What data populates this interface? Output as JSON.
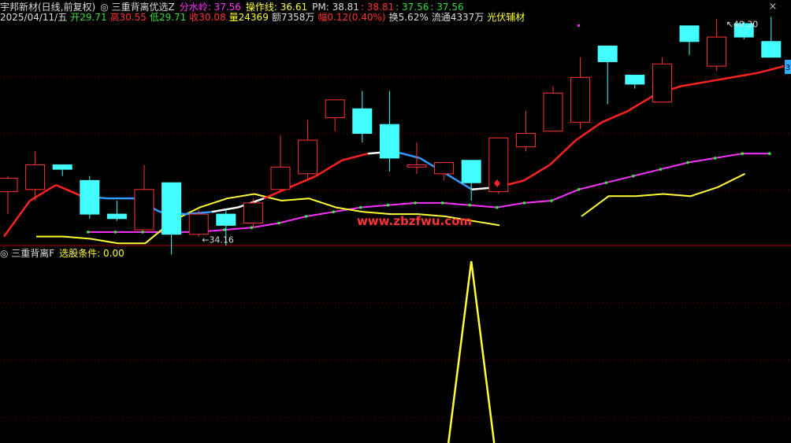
{
  "header": {
    "stock_name": "宇邦新材",
    "period": "(日线,前复权)",
    "indicator_name": "三重背离优选Z",
    "line1": [
      {
        "label": "分水岭:",
        "value": "37.56",
        "color": "#ff33ff"
      },
      {
        "label": "操作线:",
        "value": "36.61",
        "color": "#ffff33"
      },
      {
        "label": "PM:",
        "value": "38.81",
        "color": "#dddddd"
      },
      {
        "label": "",
        "value": ": 38.81",
        "color": "#ff3333"
      },
      {
        "label": "",
        "value": ": 37.56",
        "color": "#33dd33"
      },
      {
        "label": "",
        "value": ": 37.56",
        "color": "#33dd33"
      }
    ],
    "line2": [
      {
        "label": "2025/04/11/五",
        "value": "",
        "color": "#dddddd"
      },
      {
        "label": "开",
        "value": "29.71",
        "color": "#33dd33"
      },
      {
        "label": "高",
        "value": "30.55",
        "color": "#ff3333"
      },
      {
        "label": "低",
        "value": "29.71",
        "color": "#33dd33"
      },
      {
        "label": "收",
        "value": "30.08",
        "color": "#ff3333"
      },
      {
        "label": "量",
        "value": "24369",
        "color": "#ffff33"
      },
      {
        "label": "额",
        "value": "7358万",
        "color": "#dddddd"
      },
      {
        "label": "幅",
        "value": "0.12(0.40%)",
        "color": "#ff3333"
      },
      {
        "label": "换",
        "value": "5.62%",
        "color": "#dddddd"
      },
      {
        "label": "流通",
        "value": "4337万",
        "color": "#dddddd"
      },
      {
        "label": "光伏辅材",
        "value": "",
        "color": "#ffff33"
      }
    ]
  },
  "lower_panel": {
    "indicator_name": "三重背离F",
    "label": "选股条件:",
    "value": "0.00"
  },
  "watermark": "www.zbzfwu.com",
  "right_edge_label": "3",
  "close_icon": "×",
  "colors": {
    "up": "#ff3333",
    "down": "#44ffff",
    "fenshuiling": "#ff33ff",
    "caozuo": "#ffff33",
    "pm_up": "#ff2222",
    "pm_neutral": "#ffffff",
    "pm_down": "#3399ff",
    "grid": "#8b0000"
  },
  "chart_data": {
    "type": "candlestick",
    "candles": [
      {
        "o": 34.9,
        "c": 35.5,
        "h": 35.6,
        "l": 33.9
      },
      {
        "o": 35.0,
        "c": 36.1,
        "h": 36.7,
        "l": 34.5
      },
      {
        "o": 36.1,
        "c": 35.9,
        "h": 36.1,
        "l": 35.6
      },
      {
        "o": 35.4,
        "c": 33.9,
        "h": 35.6,
        "l": 33.7
      },
      {
        "o": 33.9,
        "c": 33.7,
        "h": 34.5,
        "l": 33.6
      },
      {
        "o": 33.2,
        "c": 35.0,
        "h": 36.1,
        "l": 33.2
      },
      {
        "o": 35.3,
        "c": 33.0,
        "h": 35.3,
        "l": 32.1
      },
      {
        "o": 33.0,
        "c": 33.9,
        "h": 34.1,
        "l": 32.9
      },
      {
        "o": 33.9,
        "c": 33.4,
        "h": 34.1,
        "l": 32.5
      },
      {
        "o": 33.5,
        "c": 34.4,
        "h": 34.6,
        "l": 33.3
      },
      {
        "o": 35.0,
        "c": 36.0,
        "h": 37.4,
        "l": 35.0
      },
      {
        "o": 35.7,
        "c": 37.2,
        "h": 38.1,
        "l": 35.5
      },
      {
        "o": 38.2,
        "c": 39.0,
        "h": 39.0,
        "l": 37.6
      },
      {
        "o": 38.6,
        "c": 37.5,
        "h": 39.4,
        "l": 37.1
      },
      {
        "o": 37.9,
        "c": 36.4,
        "h": 39.4,
        "l": 35.8
      },
      {
        "o": 36.0,
        "c": 36.1,
        "h": 37.1,
        "l": 35.7
      },
      {
        "o": 35.7,
        "c": 36.2,
        "h": 36.2,
        "l": 35.4
      },
      {
        "o": 36.3,
        "c": 35.3,
        "h": 36.3,
        "l": 34.5
      },
      {
        "o": 34.9,
        "c": 37.3,
        "h": 37.3,
        "l": 34.8
      },
      {
        "o": 36.9,
        "c": 37.5,
        "h": 38.5,
        "l": 36.7
      },
      {
        "o": 37.6,
        "c": 39.3,
        "h": 39.6,
        "l": 37.6
      },
      {
        "o": 38.0,
        "c": 40.0,
        "h": 40.9,
        "l": 37.7
      },
      {
        "o": 41.4,
        "c": 40.7,
        "h": 41.4,
        "l": 38.8
      },
      {
        "o": 40.1,
        "c": 39.7,
        "h": 40.1,
        "l": 39.5
      },
      {
        "o": 38.9,
        "c": 40.6,
        "h": 40.9,
        "l": 38.9
      },
      {
        "o": 42.3,
        "c": 41.6,
        "h": 42.3,
        "l": 41.0
      },
      {
        "o": 40.5,
        "c": 41.8,
        "h": 42.6,
        "l": 40.3
      },
      {
        "o": 42.4,
        "c": 41.8,
        "h": 42.5,
        "l": 41.7
      },
      {
        "o": 41.6,
        "c": 40.9,
        "h": 42.7,
        "l": 40.9
      }
    ],
    "series": [
      {
        "name": "分水岭",
        "values": [
          null,
          null,
          null,
          33.1,
          33.1,
          33.1,
          33.1,
          33.1,
          33.2,
          33.3,
          33.5,
          33.8,
          34.0,
          34.2,
          34.3,
          34.4,
          34.4,
          34.3,
          34.2,
          34.4,
          34.5,
          35.0,
          35.3,
          35.6,
          35.9,
          36.2,
          36.4,
          36.6,
          36.6
        ]
      },
      {
        "name": "操作线",
        "values": [
          null,
          null,
          null,
          null,
          null,
          null,
          null,
          null,
          null,
          null,
          32.9,
          32.9,
          32.8,
          32.6,
          32.6,
          33.6,
          34.2,
          34.6,
          34.8,
          34.5,
          34.6,
          34.2,
          34.0,
          33.9,
          33.9,
          33.8,
          33.6,
          33.4,
          null,
          null,
          33.8,
          34.7,
          34.7,
          34.8,
          34.7,
          35.1,
          35.7
        ]
      },
      {
        "name": "PM",
        "values": [
          32.9,
          34.5,
          35.2,
          34.7,
          34.6,
          34.6,
          34.0,
          33.9,
          34.0,
          34.2,
          34.6,
          35.1,
          35.6,
          36.3,
          36.6,
          36.7,
          36.4,
          35.7,
          35.0,
          35.1,
          35.4,
          36.1,
          37.2,
          38.0,
          38.5,
          39.2,
          39.6,
          39.8,
          40.0,
          40.2,
          40.5
        ]
      },
      {
        "name": "三重背离F",
        "values": [
          0,
          0,
          0,
          0,
          0,
          0,
          0,
          0,
          0,
          0,
          0,
          0,
          0,
          0,
          0,
          0,
          0,
          1,
          0,
          0,
          0,
          0,
          0,
          0,
          0,
          0,
          0,
          0,
          0
        ]
      }
    ],
    "annotations": [
      {
        "text": "40.30",
        "type": "high"
      },
      {
        "text": "34.16",
        "type": "low"
      }
    ],
    "ylim": [
      32.5,
      42.4
    ]
  }
}
